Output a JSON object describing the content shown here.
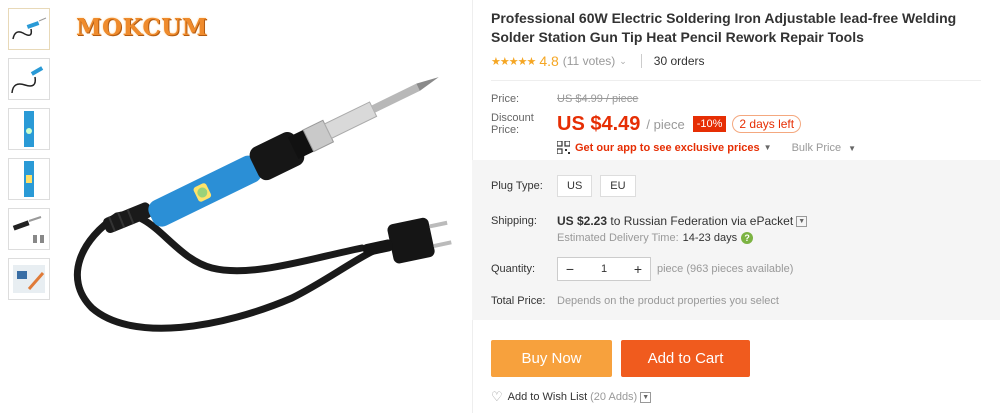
{
  "brand": "MOKCUM",
  "product": {
    "title": "Professional 60W Electric Soldering Iron Adjustable lead-free Welding Solder Station Gun Tip Heat Pencil Rework Repair Tools",
    "stars": "★★★★★",
    "rating": "4.8",
    "votes": "(11 votes)",
    "orders": "30 orders"
  },
  "price": {
    "label": "Price:",
    "old": "US $4.99 / piece",
    "discount_label_1": "Discount",
    "discount_label_2": "Price:",
    "current": "US $4.49",
    "per": "/ piece",
    "off": "-10%",
    "days_left": "2 days left",
    "app_promo": "Get our app to see exclusive prices",
    "bulk": "Bulk Price"
  },
  "plug": {
    "label": "Plug Type:",
    "options": [
      "US",
      "EU"
    ]
  },
  "shipping": {
    "label": "Shipping:",
    "price": "US $2.23",
    "to": "to Russian Federation via ePacket",
    "delivery_label": "Estimated Delivery Time:",
    "delivery_days": "14-23 days"
  },
  "quantity": {
    "label": "Quantity:",
    "value": "1",
    "available": "piece (963 pieces available)"
  },
  "total": {
    "label": "Total Price:",
    "value": "Depends on the product properties you select"
  },
  "actions": {
    "buy": "Buy Now",
    "cart": "Add to Cart",
    "wish": "Add to Wish List",
    "wish_count": "(20 Adds)"
  },
  "colors": {
    "accent": "#e62e04",
    "buy": "#f7a13d",
    "cart": "#f05b1e",
    "star": "#f5a623"
  }
}
